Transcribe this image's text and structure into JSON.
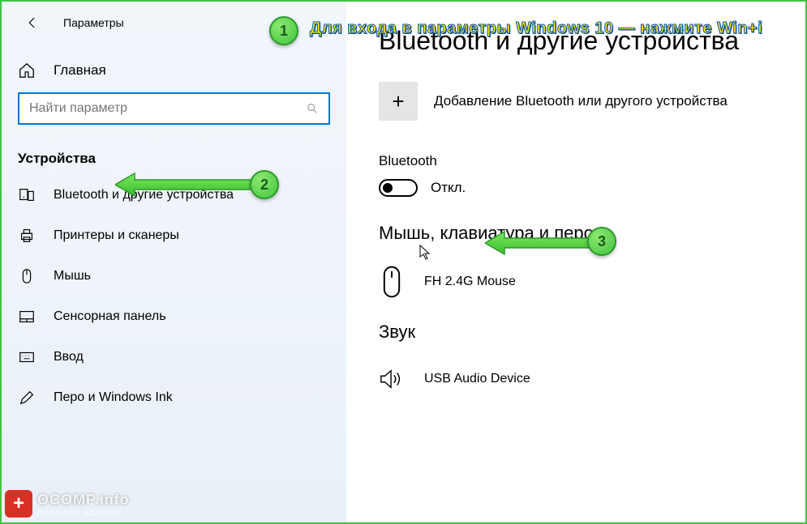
{
  "header": {
    "title": "Параметры"
  },
  "sidebar": {
    "home": "Главная",
    "search_placeholder": "Найти параметр",
    "section": "Устройства",
    "items": [
      {
        "label": "Bluetooth и другие устройства"
      },
      {
        "label": "Принтеры и сканеры"
      },
      {
        "label": "Мышь"
      },
      {
        "label": "Сенсорная панель"
      },
      {
        "label": "Ввод"
      },
      {
        "label": "Перо и Windows Ink"
      }
    ]
  },
  "main": {
    "heading": "Bluetooth и другие устройства",
    "add_label": "Добавление Bluetooth или другого устройства",
    "bt_label": "Bluetooth",
    "bt_state": "Откл.",
    "section_mouse": "Мышь, клавиатура и перо",
    "mouse_device": "FH 2.4G Mouse",
    "section_audio": "Звук",
    "audio_device": "USB Audio Device"
  },
  "annotations": {
    "banner": "Для входа в параметры Windows 10 — нажмите Win+i",
    "n1": "1",
    "n2": "2",
    "n3": "3"
  },
  "watermark": {
    "main": "OCOMP.info",
    "sub": "ВОПРОСЫ АДМИНУ"
  }
}
